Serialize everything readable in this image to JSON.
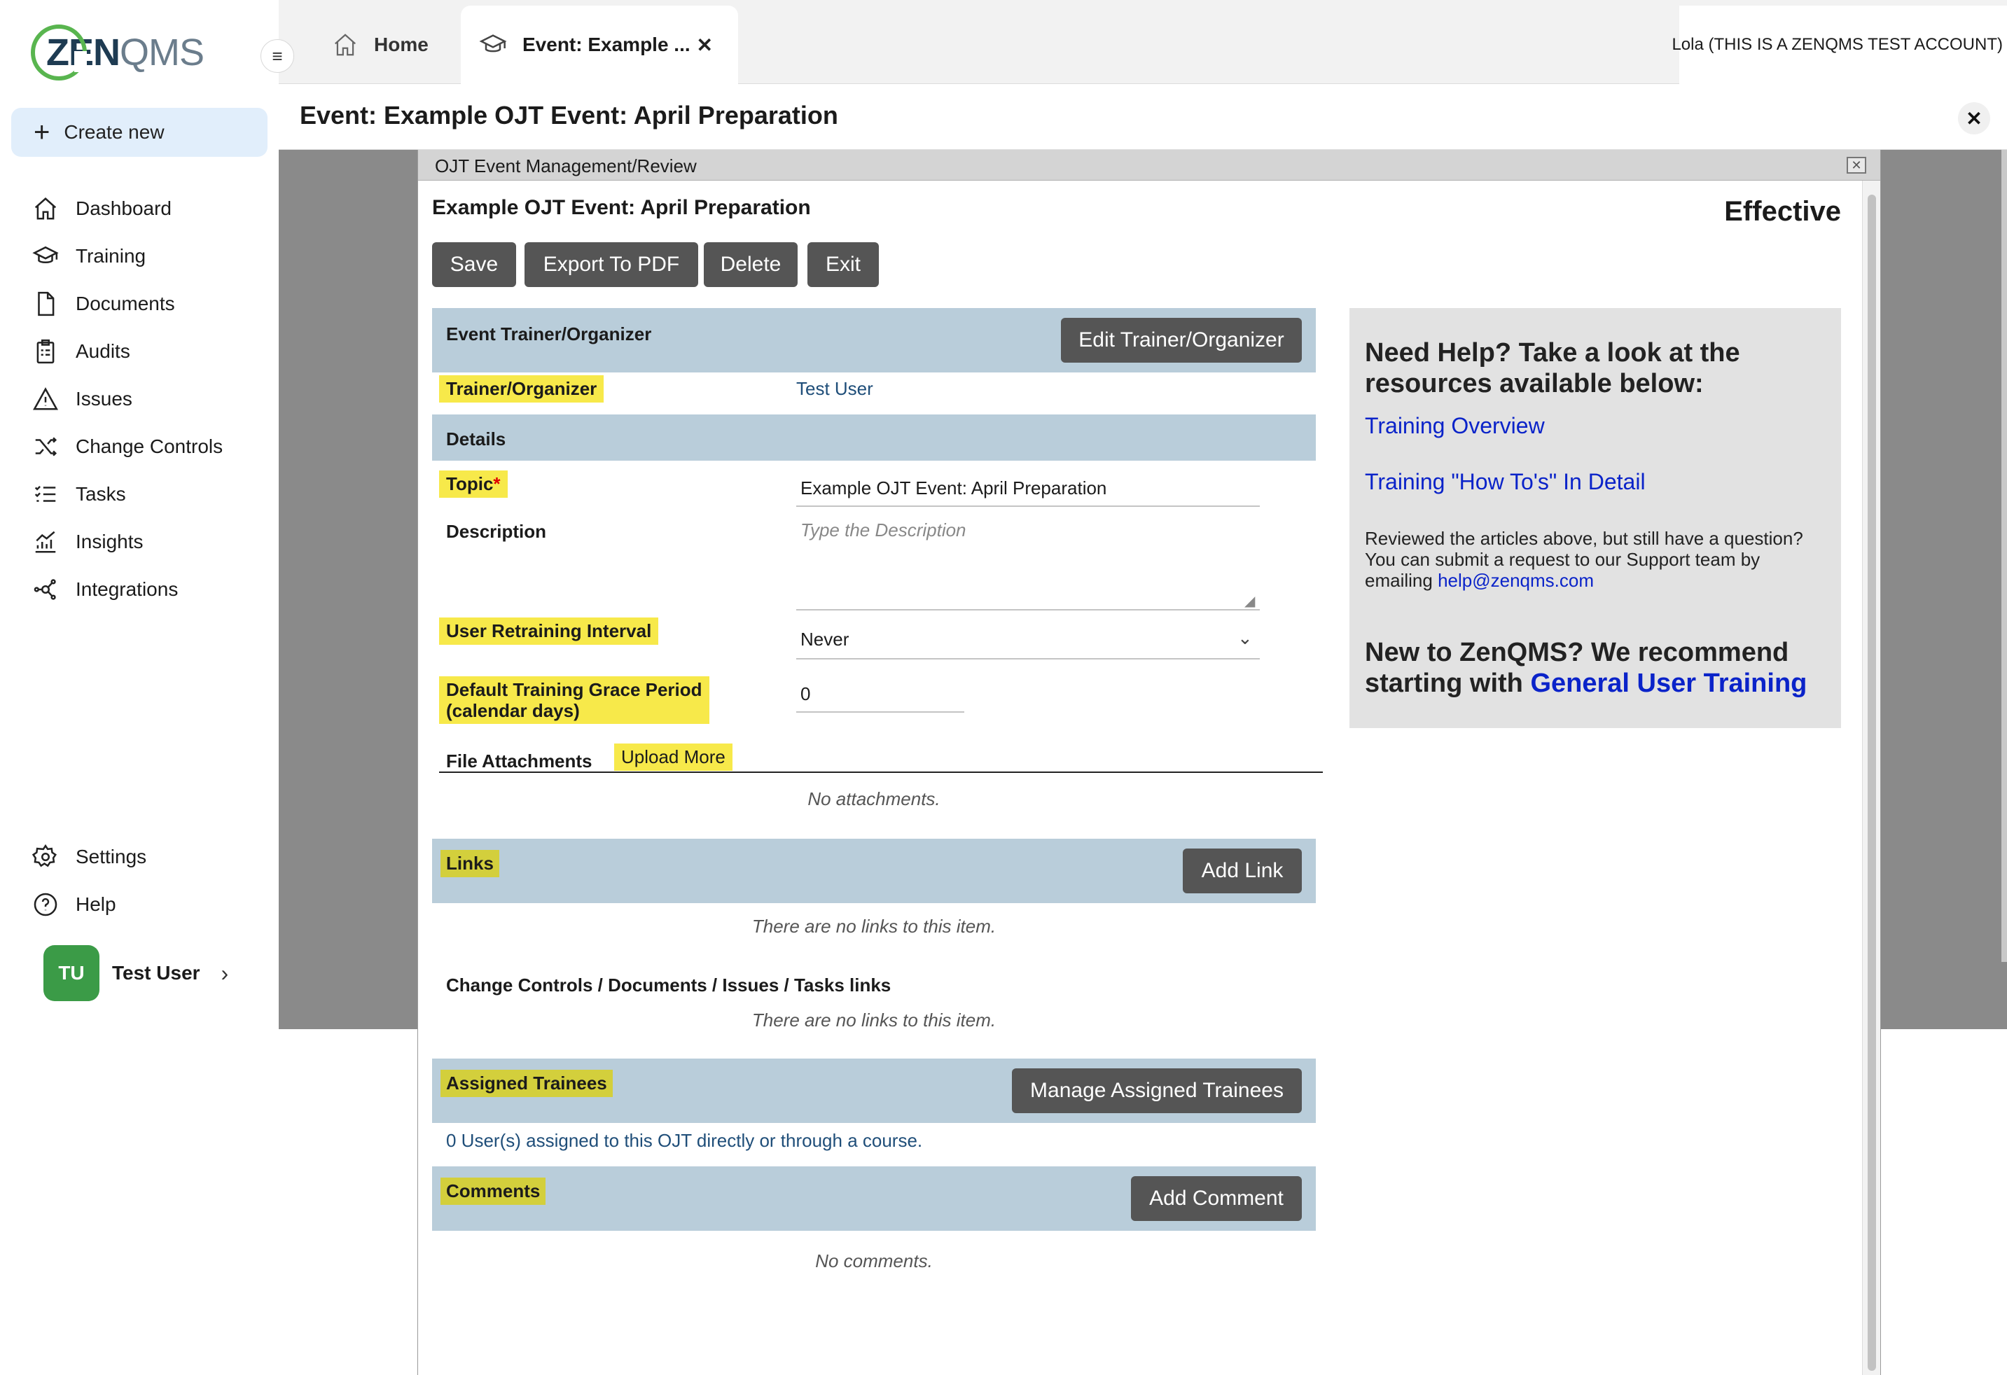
{
  "app": {
    "logo_zen": "ZEN",
    "logo_qms": "QMS",
    "create_new": "Create new"
  },
  "sidebar": {
    "items": [
      {
        "label": "Dashboard",
        "icon": "home-icon"
      },
      {
        "label": "Training",
        "icon": "graduation-cap-icon"
      },
      {
        "label": "Documents",
        "icon": "document-icon"
      },
      {
        "label": "Audits",
        "icon": "clipboard-icon"
      },
      {
        "label": "Issues",
        "icon": "warning-icon"
      },
      {
        "label": "Change Controls",
        "icon": "shuffle-icon"
      },
      {
        "label": "Tasks",
        "icon": "checklist-icon"
      },
      {
        "label": "Insights",
        "icon": "chart-icon"
      },
      {
        "label": "Integrations",
        "icon": "integrations-icon"
      }
    ],
    "bottom": [
      {
        "label": "Settings",
        "icon": "gear-icon"
      },
      {
        "label": "Help",
        "icon": "help-icon"
      }
    ],
    "user": {
      "initials": "TU",
      "name": "Test User"
    }
  },
  "tabs": {
    "home": "Home",
    "event": "Event: Example ...",
    "account": "Lola (THIS IS A ZENQMS TEST ACCOUNT)"
  },
  "page": {
    "title": "Event: Example OJT Event: April Preparation"
  },
  "modal": {
    "header": "OJT Event Management/Review",
    "event_title": "Example OJT Event: April Preparation",
    "status": "Effective",
    "buttons": {
      "save": "Save",
      "export": "Export To PDF",
      "delete": "Delete",
      "exit": "Exit"
    },
    "trainer_section": {
      "label": "Event Trainer/Organizer",
      "button": "Edit Trainer/Organizer",
      "field_label": "Trainer/Organizer",
      "field_value": "Test User"
    },
    "details": {
      "label": "Details",
      "topic_label": "Topic",
      "required_mark": "*",
      "topic_value": "Example OJT Event: April Preparation",
      "description_label": "Description",
      "description_placeholder": "Type the Description",
      "retraining_label": "User Retraining Interval",
      "retraining_value": "Never",
      "grace_label_1": "Default Training Grace Period",
      "grace_label_2": "(calendar days)",
      "grace_value": "0",
      "attachments_label": "File Attachments",
      "upload_more": "Upload More",
      "no_attachments": "No attachments."
    },
    "links": {
      "label": "Links",
      "button": "Add Link",
      "empty": "There are no links to this item.",
      "sub_label": "Change Controls / Documents / Issues / Tasks links",
      "sub_empty": "There are no links to this item."
    },
    "trainees": {
      "label": "Assigned Trainees",
      "button": "Manage Assigned Trainees",
      "summary": "0 User(s) assigned to this OJT directly or through a course."
    },
    "comments": {
      "label": "Comments",
      "button": "Add Comment",
      "empty": "No comments."
    }
  },
  "help": {
    "heading": "Need Help? Take a look at the resources available below:",
    "link1": "Training Overview",
    "link2": "Training \"How To's\" In Detail",
    "para": "Reviewed the articles above, but still have a question? You can submit a request to our Support team by emailing",
    "email": "help@zenqms.com",
    "heading2_prefix": "New to ZenQMS? We recommend starting with",
    "heading2_link": "General User Training"
  },
  "colors": {
    "accent_green": "#3b9b47",
    "section_blue": "#b9cdda",
    "highlight_yellow": "#f7e94a",
    "link_blue": "#0a23c9",
    "button_gray": "#555555"
  }
}
